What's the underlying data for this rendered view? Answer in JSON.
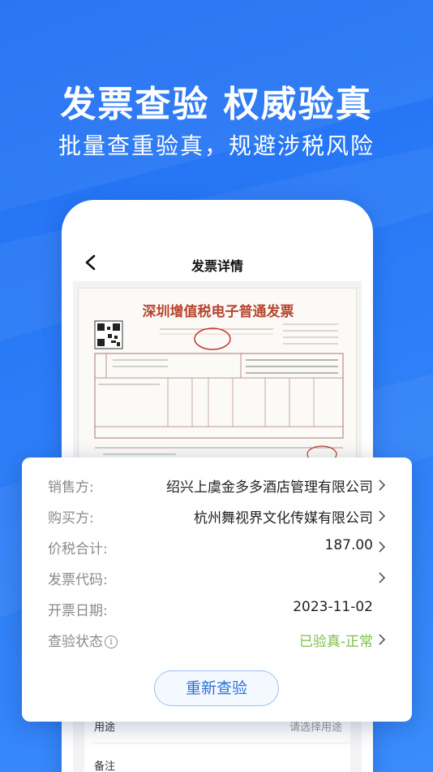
{
  "headline": "发票查验 权威验真",
  "subline": "批量查重验真，规避涉税风险",
  "phone": {
    "title": "发票详情",
    "invoice_title": "深圳增值税电子普通发票",
    "usage_label": "用途",
    "usage_hint": "请选择用途",
    "remark_label": "备注"
  },
  "card": {
    "fields": [
      {
        "label": "销售方:",
        "value": "绍兴上虞金多多酒店管理有限公司",
        "chevron": true
      },
      {
        "label": "购买方:",
        "value": "杭州舞视界文化传媒有限公司",
        "chevron": true
      },
      {
        "label": "价税合计:",
        "value": "187.00",
        "chevron": true
      },
      {
        "label": "发票代码:",
        "value": "",
        "chevron": true
      },
      {
        "label": "开票日期:",
        "value": "2023-11-02",
        "chevron": false
      },
      {
        "label": "查验状态",
        "value": "已验真-正常",
        "chevron": true
      }
    ],
    "recheck_label": "重新查验"
  },
  "colors": {
    "brand_blue": "#2b7cf7",
    "status_ok": "#7cbf44",
    "invoice_red": "#b7452f"
  }
}
